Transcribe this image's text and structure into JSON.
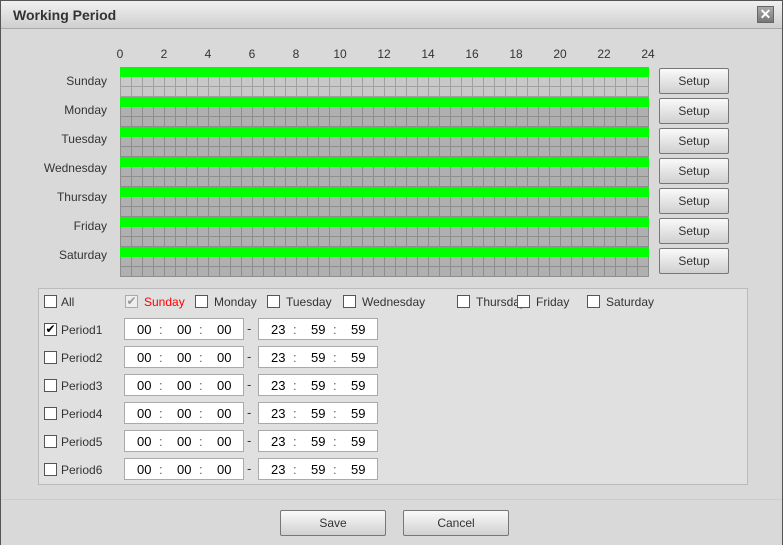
{
  "title": "Working Period",
  "hour_labels": [
    "0",
    "2",
    "4",
    "6",
    "8",
    "10",
    "12",
    "14",
    "16",
    "18",
    "20",
    "22",
    "24"
  ],
  "days": [
    {
      "label": "Sunday",
      "setup": "Setup",
      "schedule_hours": [
        0,
        24
      ],
      "selected": true
    },
    {
      "label": "Monday",
      "setup": "Setup",
      "schedule_hours": [
        0,
        24
      ]
    },
    {
      "label": "Tuesday",
      "setup": "Setup",
      "schedule_hours": [
        0,
        24
      ]
    },
    {
      "label": "Wednesday",
      "setup": "Setup",
      "schedule_hours": [
        0,
        24
      ]
    },
    {
      "label": "Thursday",
      "setup": "Setup",
      "schedule_hours": [
        0,
        24
      ]
    },
    {
      "label": "Friday",
      "setup": "Setup",
      "schedule_hours": [
        0,
        24
      ]
    },
    {
      "label": "Saturday",
      "setup": "Setup",
      "schedule_hours": [
        0,
        24
      ]
    }
  ],
  "day_checks": {
    "all": "All",
    "items": [
      {
        "label": "Sunday",
        "checked": true,
        "disabled": true
      },
      {
        "label": "Monday",
        "checked": false
      },
      {
        "label": "Tuesday",
        "checked": false
      },
      {
        "label": "Wednesday",
        "checked": false
      },
      {
        "label": "Thursday",
        "checked": false
      },
      {
        "label": "Friday",
        "checked": false
      },
      {
        "label": "Saturday",
        "checked": false
      }
    ]
  },
  "periods": [
    {
      "label": "Period1",
      "checked": true,
      "start": [
        "00",
        "00",
        "00"
      ],
      "end": [
        "23",
        "59",
        "59"
      ]
    },
    {
      "label": "Period2",
      "checked": false,
      "start": [
        "00",
        "00",
        "00"
      ],
      "end": [
        "23",
        "59",
        "59"
      ]
    },
    {
      "label": "Period3",
      "checked": false,
      "start": [
        "00",
        "00",
        "00"
      ],
      "end": [
        "23",
        "59",
        "59"
      ]
    },
    {
      "label": "Period4",
      "checked": false,
      "start": [
        "00",
        "00",
        "00"
      ],
      "end": [
        "23",
        "59",
        "59"
      ]
    },
    {
      "label": "Period5",
      "checked": false,
      "start": [
        "00",
        "00",
        "00"
      ],
      "end": [
        "23",
        "59",
        "59"
      ]
    },
    {
      "label": "Period6",
      "checked": false,
      "start": [
        "00",
        "00",
        "00"
      ],
      "end": [
        "23",
        "59",
        "59"
      ]
    }
  ],
  "separator": ":",
  "dash": "-",
  "check_mark": "✔",
  "save": "Save",
  "cancel": "Cancel",
  "close": "✕",
  "colors": {
    "schedule": "#00ff00",
    "selected_day": "#ff0000"
  }
}
